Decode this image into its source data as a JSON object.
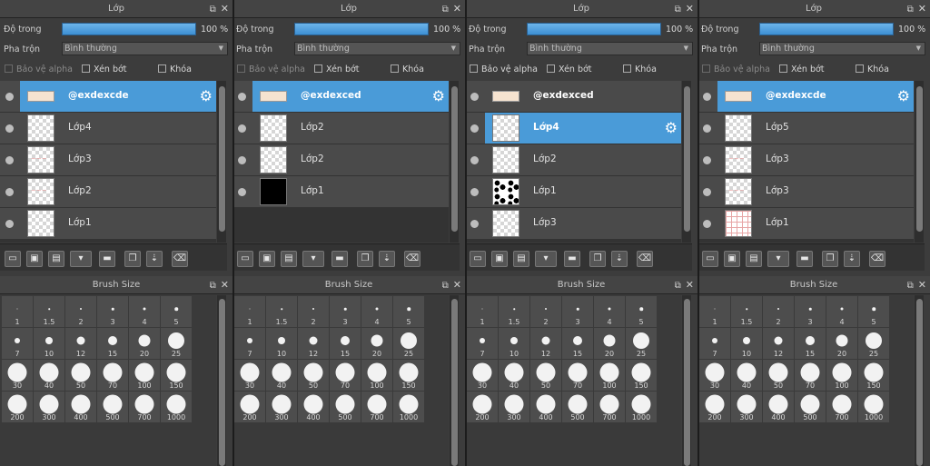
{
  "layer_title": "Lớp",
  "brush_title": "Brush Size",
  "labels": {
    "opacity": "Độ trong",
    "blend": "Pha trộn",
    "protect_alpha": "Bảo vệ alpha",
    "clipping": "Xén bớt",
    "lock": "Khóa"
  },
  "window_buttons": {
    "popout": "⧉",
    "close": "✕"
  },
  "opacity_value": "100 %",
  "blend_mode": "Bình thường",
  "brush_sizes": [
    "1",
    "1.5",
    "2",
    "3",
    "4",
    "5",
    "7",
    "10",
    "12",
    "15",
    "20",
    "25",
    "30",
    "40",
    "50",
    "70",
    "100",
    "150",
    "200",
    "300",
    "400",
    "500",
    "700",
    "1000"
  ],
  "toolbar_icons": [
    "new-layer-icon",
    "new-raster-icon",
    "new-vector-icon",
    "add-layer-menu-icon",
    "folder-icon",
    "duplicate-icon",
    "merge-down-icon",
    "trash-icon"
  ],
  "panels": [
    {
      "layers": [
        {
          "name": "@exdexcde",
          "selected": true,
          "thumb": "wide"
        },
        {
          "name": "Lớp4",
          "selected": false,
          "thumb": "check"
        },
        {
          "name": "Lớp3",
          "selected": false,
          "thumb": "pink"
        },
        {
          "name": "Lớp2",
          "selected": false,
          "thumb": "pink"
        },
        {
          "name": "Lớp1",
          "selected": false,
          "thumb": "check"
        }
      ]
    },
    {
      "layers": [
        {
          "name": "@exdexced",
          "selected": true,
          "thumb": "wide"
        },
        {
          "name": "Lớp2",
          "selected": false,
          "thumb": "check"
        },
        {
          "name": "Lớp2",
          "selected": false,
          "thumb": "check"
        },
        {
          "name": "Lớp1",
          "selected": false,
          "thumb": "black"
        }
      ]
    },
    {
      "layers": [
        {
          "name": "@exdexced",
          "selected": false,
          "thumb": "wide"
        },
        {
          "name": "Lớp4",
          "selected": true,
          "thumb": "check"
        },
        {
          "name": "Lớp2",
          "selected": false,
          "thumb": "check"
        },
        {
          "name": "Lớp1",
          "selected": false,
          "thumb": "cow"
        },
        {
          "name": "Lớp3",
          "selected": false,
          "thumb": "check"
        }
      ]
    },
    {
      "layers": [
        {
          "name": "@exdexcde",
          "selected": true,
          "thumb": "wide"
        },
        {
          "name": "Lớp5",
          "selected": false,
          "thumb": "check"
        },
        {
          "name": "Lớp3",
          "selected": false,
          "thumb": "pink"
        },
        {
          "name": "Lớp3",
          "selected": false,
          "thumb": "pink"
        },
        {
          "name": "Lớp1",
          "selected": false,
          "thumb": "grid"
        }
      ]
    }
  ],
  "colors": {
    "accent": "#4a9bd8",
    "panel_bg": "#3c3c3c",
    "row_bg": "#4a4a4a",
    "opacity_fill": "#5aa8e4"
  }
}
